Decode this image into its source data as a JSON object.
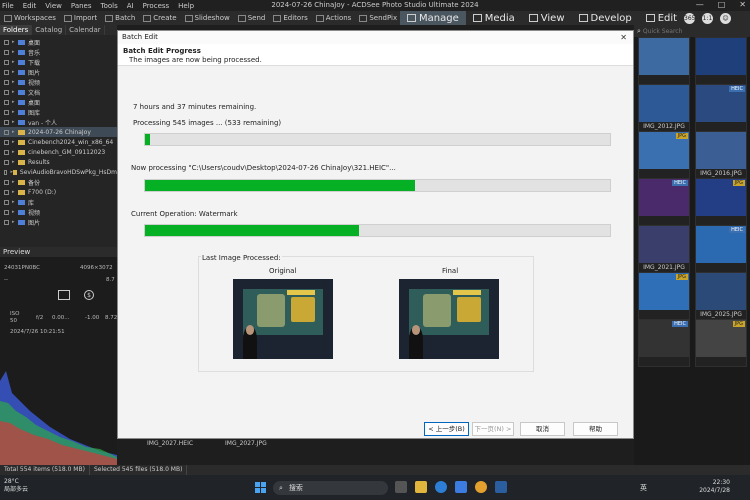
{
  "app": {
    "title": "2024-07-26 ChinaJoy - ACDSee Photo Studio Ultimate 2024",
    "menu": [
      "File",
      "Edit",
      "View",
      "Panes",
      "Tools",
      "AI",
      "Process",
      "Help"
    ],
    "window_controls": [
      "—",
      "□",
      "✕"
    ]
  },
  "toolbar": {
    "items": [
      "Workspaces",
      "Import",
      "Batch",
      "Create",
      "Slideshow",
      "Send",
      "Editors",
      "Actions",
      "SendPix"
    ],
    "modes": [
      {
        "label": "Manage",
        "active": true
      },
      {
        "label": "Media",
        "active": false
      },
      {
        "label": "View",
        "active": false
      },
      {
        "label": "Develop",
        "active": false
      },
      {
        "label": "Edit",
        "active": false
      }
    ],
    "circles": [
      "365",
      "1:1",
      "😊"
    ]
  },
  "left_panel": {
    "tabs": [
      "Folders",
      "Catalog",
      "Calendar"
    ],
    "tree": [
      {
        "label": "桌面",
        "type": "blue"
      },
      {
        "label": "音乐",
        "type": "blue"
      },
      {
        "label": "下载",
        "type": "blue"
      },
      {
        "label": "图片",
        "type": "blue"
      },
      {
        "label": "视频",
        "type": "blue"
      },
      {
        "label": "文档",
        "type": "blue"
      },
      {
        "label": "桌面",
        "type": "blue"
      },
      {
        "label": "图库",
        "type": "blue"
      },
      {
        "label": "van - 个人",
        "type": "blue"
      },
      {
        "label": "2024-07-26 ChinaJoy",
        "type": "yellow",
        "selected": true
      },
      {
        "label": "Cinebench2024_win_x86_64",
        "type": "yellow"
      },
      {
        "label": "cinebench_GM_09112023",
        "type": "yellow"
      },
      {
        "label": "Results",
        "type": "yellow"
      },
      {
        "label": "SeviAudioBravoHDSwPkg_HsDm",
        "type": "yellow"
      },
      {
        "label": "备份",
        "type": "yellow"
      },
      {
        "label": "F700 (D:)",
        "type": "yellow"
      },
      {
        "label": "库",
        "type": "blue"
      },
      {
        "label": "视频",
        "type": "blue"
      },
      {
        "label": "图片",
        "type": "blue"
      }
    ],
    "preview_title": "Preview",
    "preview_info": {
      "name": "24031PN0BC",
      "size": "4096×3072",
      "dash": "--",
      "iso_label": "ISO",
      "iso": "50",
      "aperture": "f/2",
      "val1": "0.00...",
      "ev": "-1.00",
      "val2": "8.72",
      "date": "2024/7/26 10:21:51",
      "side": "8.7"
    }
  },
  "thumbs": {
    "search_placeholder": "Quick Search",
    "items": [
      {
        "badge": "",
        "badge_type": "",
        "caption": "",
        "color": "#3d6aa0"
      },
      {
        "badge": "",
        "badge_type": "",
        "caption": "",
        "color": "#1f3f7a"
      },
      {
        "badge": "",
        "badge_type": "",
        "caption": "IMG_2012.JPG",
        "color": "#2d5a96"
      },
      {
        "badge": "HEIC",
        "badge_type": "heic",
        "caption": "",
        "color": "#2a4a80"
      },
      {
        "badge": "JPG",
        "badge_type": "jpg",
        "caption": "",
        "color": "#3a6fb0"
      },
      {
        "badge": "",
        "badge_type": "",
        "caption": "IMG_2016.JPG",
        "color": "#3b5f94"
      },
      {
        "badge": "HEIC",
        "badge_type": "heic",
        "caption": "",
        "color": "#4a2a6a"
      },
      {
        "badge": "JPG",
        "badge_type": "jpg",
        "caption": "",
        "color": "#243e86"
      },
      {
        "badge": "",
        "badge_type": "",
        "caption": "IMG_2021.JPG",
        "color": "#3a3e6a"
      },
      {
        "badge": "HEIC",
        "badge_type": "heic",
        "caption": "",
        "color": "#2b6ab0"
      },
      {
        "badge": "JPG",
        "badge_type": "jpg",
        "caption": "",
        "color": "#2f6fb8"
      },
      {
        "badge": "",
        "badge_type": "",
        "caption": "IMG_2025.JPG",
        "color": "#2b4a78"
      },
      {
        "badge": "HEIC",
        "badge_type": "heic",
        "caption": "",
        "color": "#333"
      },
      {
        "badge": "JPG",
        "badge_type": "jpg",
        "caption": "",
        "color": "#444"
      }
    ],
    "bottom_captions": [
      "IMG_2027.HEIC",
      "IMG_2027.JPG"
    ]
  },
  "statusbar": {
    "total": "Total 554 items  (518.0 MB)",
    "selected": "Selected 545 files (518.0 MB)"
  },
  "taskbar": {
    "weather_temp": "28°C",
    "weather_desc": "局部多云",
    "search_label": "搜索",
    "ime": "英",
    "time": "22:30",
    "date": "2024/7/28"
  },
  "dialog": {
    "title": "Batch Edit",
    "heading": "Batch Edit Progress",
    "subheading": "The images are now being processed.",
    "time_remaining": "7 hours and 37 minutes remaining.",
    "processing_count": "Processing 545 images ... (533 remaining)",
    "overall_progress": 0.01,
    "now_processing": "Now processing \"C:\\Users\\coudv\\Desktop\\2024-07-26 ChinaJoy\\321.HEIC\"...",
    "file_progress": 0.58,
    "current_operation": "Current Operation: Watermark",
    "operation_progress": 0.46,
    "last_image_label": "Last Image Processed:",
    "original_label": "Original",
    "final_label": "Final",
    "buttons": {
      "back": "< 上一步(B)",
      "next": "下一页(N) >",
      "cancel": "取消",
      "help": "帮助"
    }
  }
}
